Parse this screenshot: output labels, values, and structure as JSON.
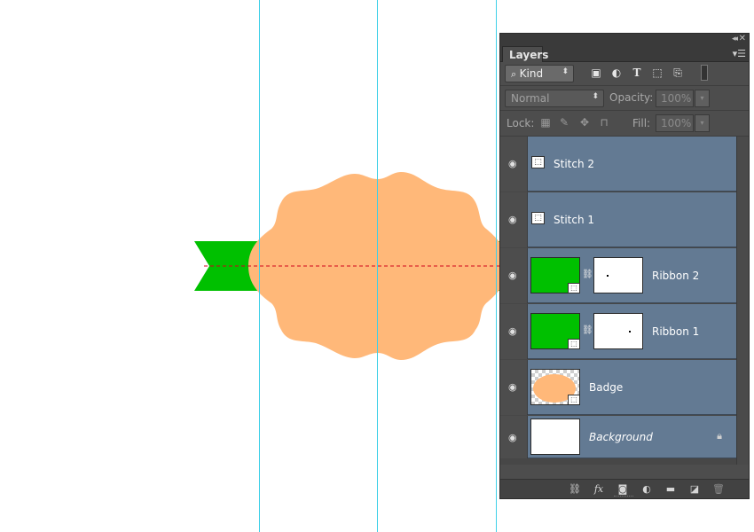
{
  "panel": {
    "tab_label": "Layers",
    "filter_kind": "Kind",
    "blend_mode": "Normal",
    "opacity_label": "Opacity:",
    "opacity_value": "100%",
    "lock_label": "Lock:",
    "fill_label": "Fill:",
    "fill_value": "100%",
    "filter_icons": [
      "image-filter-icon",
      "adjustment-filter-icon",
      "type-filter-icon",
      "shape-filter-icon",
      "smart-object-filter-icon",
      "filter-toggle-icon"
    ],
    "lock_icons": [
      "lock-transparent-icon",
      "lock-image-icon",
      "lock-position-icon",
      "lock-all-icon"
    ],
    "footer_icons": [
      "link-layers-icon",
      "fx-icon",
      "add-mask-icon",
      "adjustment-layer-icon",
      "group-folder-icon",
      "new-layer-icon",
      "trash-icon"
    ]
  },
  "layers": [
    {
      "name": "Stitch 2",
      "kind": "shape-small"
    },
    {
      "name": "Stitch 1",
      "kind": "shape-small"
    },
    {
      "name": "Ribbon 2",
      "kind": "shape-mask"
    },
    {
      "name": "Ribbon 1",
      "kind": "shape-mask"
    },
    {
      "name": "Badge",
      "kind": "shape-badge"
    },
    {
      "name": "Background",
      "kind": "background",
      "locked": true
    }
  ],
  "colors": {
    "badge": "#ffb879",
    "ribbon": "#00c000",
    "guide": "#3fd0e8",
    "stitch_line": "#d0021b",
    "layer_selected": "#637a93"
  }
}
